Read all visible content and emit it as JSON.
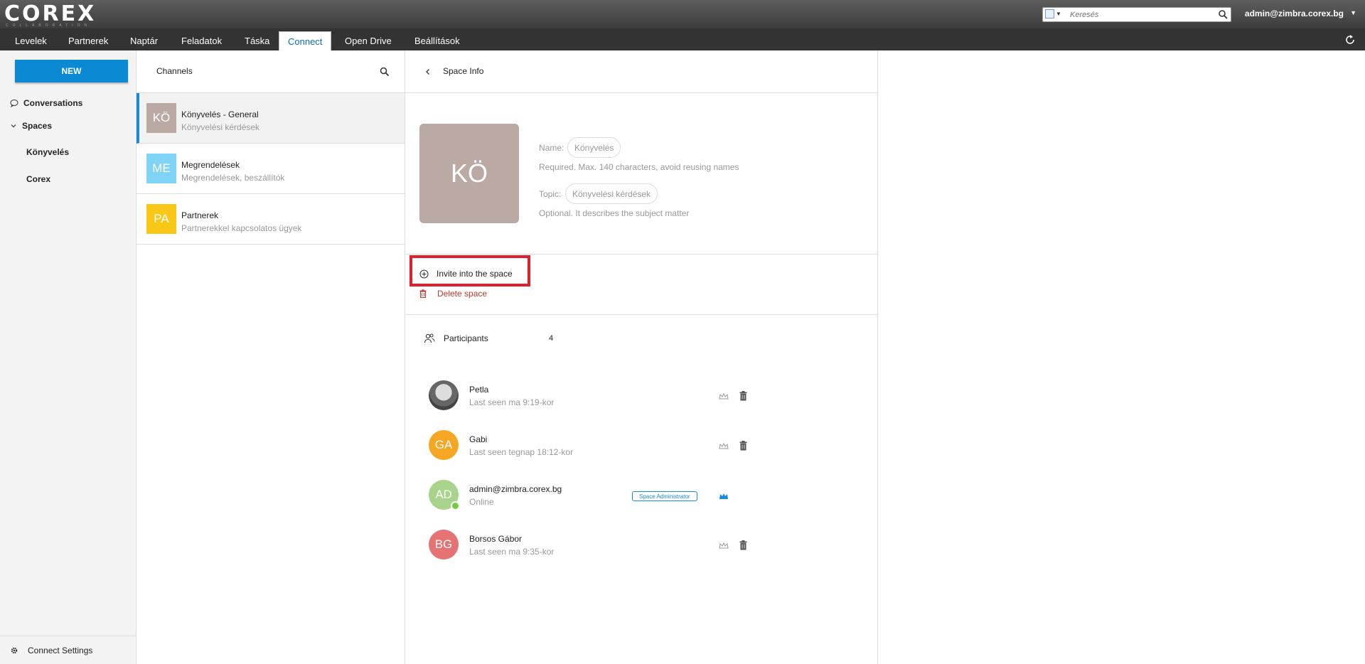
{
  "topbar": {
    "logo": "COREX",
    "logo_sub": "COLLABORATION",
    "search_placeholder": "Keresés",
    "user": "admin@zimbra.corex.bg"
  },
  "apptabs": [
    "Levelek",
    "Partnerek",
    "Naptár",
    "Feladatok",
    "Táska",
    "Connect",
    "Open Drive",
    "Beállítások"
  ],
  "active_tab": "Connect",
  "sidebar": {
    "new_label": "NEW",
    "conversations": "Conversations",
    "spaces": "Spaces",
    "space_items": [
      "Könyvelés",
      "Corex"
    ],
    "settings": "Connect Settings"
  },
  "channels": {
    "title": "Channels",
    "items": [
      {
        "initials": "KÖ",
        "name": "Könyvelés - General",
        "desc": "Könyvelési kérdések",
        "color": "#bba9a3"
      },
      {
        "initials": "ME",
        "name": "Megrendelések",
        "desc": "Megrendelések, beszállítók",
        "color": "#7fd3f5"
      },
      {
        "initials": "PA",
        "name": "Partnerek",
        "desc": "Partnerekkel kapcsolatos ügyek",
        "color": "#f9c816"
      }
    ]
  },
  "space_info": {
    "title": "Space Info",
    "avatar": "KÖ",
    "name_label": "Name:",
    "name_value": "Könyvelés",
    "name_hint": "Required. Max. 140 characters, avoid reusing names",
    "topic_label": "Topic:",
    "topic_value": "Könyvelési kérdések",
    "topic_hint": "Optional. It describes the subject matter",
    "invite": "Invite into the space",
    "delete": "Delete space",
    "participants_label": "Participants",
    "participants_count": "4",
    "admin_badge": "Space Administrator",
    "members": [
      {
        "initials": "",
        "name": "Petla",
        "status": "Last seen ma 9:19-kor",
        "color": "#666666"
      },
      {
        "initials": "GA",
        "name": "Gabi",
        "status": "Last seen tegnap 18:12-kor",
        "color": "#f5a623"
      },
      {
        "initials": "AD",
        "name": "admin@zimbra.corex.bg",
        "status": "Online",
        "color": "#a8d38a"
      },
      {
        "initials": "BG",
        "name": "Borsos Gábor",
        "status": "Last seen ma 9:35-kor",
        "color": "#e57373"
      }
    ]
  },
  "colors": {
    "accent": "#0b8ad3",
    "highlight": "#e01e2c",
    "danger": "#c0392b"
  }
}
